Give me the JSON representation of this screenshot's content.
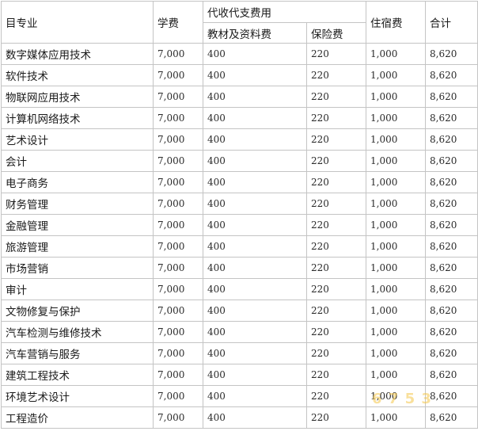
{
  "table": {
    "headers": {
      "major": "目专业",
      "tuition": "学费",
      "collected": "代收代支费用",
      "books": "教材及资料费",
      "insurance": "保险费",
      "dorm": "住宿费",
      "total": "合计"
    },
    "rows": [
      {
        "major": "数字媒体应用技术",
        "tuition": "7,000",
        "books": "400",
        "insurance": "220",
        "dorm": "1,000",
        "total": "8,620"
      },
      {
        "major": "软件技术",
        "tuition": "7,000",
        "books": "400",
        "insurance": "220",
        "dorm": "1,000",
        "total": "8,620"
      },
      {
        "major": "物联网应用技术",
        "tuition": "7,000",
        "books": "400",
        "insurance": "220",
        "dorm": "1,000",
        "total": "8,620"
      },
      {
        "major": "计算机网络技术",
        "tuition": "7,000",
        "books": "400",
        "insurance": "220",
        "dorm": "1,000",
        "total": "8,620"
      },
      {
        "major": "艺术设计",
        "tuition": "7,000",
        "books": "400",
        "insurance": "220",
        "dorm": "1,000",
        "total": "8,620"
      },
      {
        "major": "会计",
        "tuition": "7,000",
        "books": "400",
        "insurance": "220",
        "dorm": "1,000",
        "total": "8,620"
      },
      {
        "major": "电子商务",
        "tuition": "7,000",
        "books": "400",
        "insurance": "220",
        "dorm": "1,000",
        "total": "8,620"
      },
      {
        "major": "财务管理",
        "tuition": "7,000",
        "books": "400",
        "insurance": "220",
        "dorm": "1,000",
        "total": "8,620"
      },
      {
        "major": "金融管理",
        "tuition": "7,000",
        "books": "400",
        "insurance": "220",
        "dorm": "1,000",
        "total": "8,620"
      },
      {
        "major": "旅游管理",
        "tuition": "7,000",
        "books": "400",
        "insurance": "220",
        "dorm": "1,000",
        "total": "8,620"
      },
      {
        "major": "市场营销",
        "tuition": "7,000",
        "books": "400",
        "insurance": "220",
        "dorm": "1,000",
        "total": "8,620"
      },
      {
        "major": "审计",
        "tuition": "7,000",
        "books": "400",
        "insurance": "220",
        "dorm": "1,000",
        "total": "8,620"
      },
      {
        "major": "文物修复与保护",
        "tuition": "7,000",
        "books": "400",
        "insurance": "220",
        "dorm": "1,000",
        "total": "8,620"
      },
      {
        "major": "汽车检测与维修技术",
        "tuition": "7,000",
        "books": "400",
        "insurance": "220",
        "dorm": "1,000",
        "total": "8,620"
      },
      {
        "major": "汽车营销与服务",
        "tuition": "7,000",
        "books": "400",
        "insurance": "220",
        "dorm": "1,000",
        "total": "8,620"
      },
      {
        "major": "建筑工程技术",
        "tuition": "7,000",
        "books": "400",
        "insurance": "220",
        "dorm": "1,000",
        "total": "8,620"
      },
      {
        "major": "环境艺术设计",
        "tuition": "7,000",
        "books": "400",
        "insurance": "220",
        "dorm": "1,000",
        "total": "8,620"
      },
      {
        "major": "工程造价",
        "tuition": "7,000",
        "books": "400",
        "insurance": "220",
        "dorm": "1,000",
        "total": "8,620"
      }
    ]
  },
  "watermark": {
    "text": "6  7 5  3",
    "color": "#f4c64b"
  }
}
